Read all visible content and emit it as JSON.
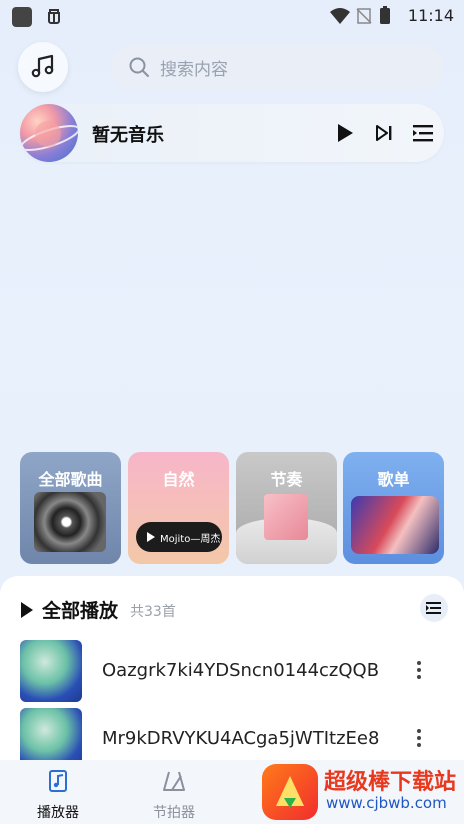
{
  "status_bar": {
    "time": "11:14"
  },
  "header": {
    "search_placeholder": "搜索内容"
  },
  "now_playing": {
    "title": "暂无音乐"
  },
  "categories": [
    {
      "label": "全部歌曲"
    },
    {
      "label": "自然",
      "chip_text": "Mojito—周杰"
    },
    {
      "label": "节奏"
    },
    {
      "label": "歌单"
    }
  ],
  "list": {
    "title": "全部播放",
    "count": "共33首",
    "items": [
      {
        "title": "Oazgrk7ki4YDSncn0144czQQB"
      },
      {
        "title": "Mr9kDRVYKU4ACga5jWTItzEe8"
      }
    ]
  },
  "bottom_nav": {
    "items": [
      {
        "label": "播放器",
        "active": true
      },
      {
        "label": "节拍器",
        "active": false
      }
    ]
  },
  "watermark": {
    "title": "超级棒下载站",
    "url": "www.cjbwb.com"
  },
  "colors": {
    "accent": "#2b6fd6",
    "watermark_red": "#e8381e",
    "watermark_blue": "#1f56c2"
  }
}
